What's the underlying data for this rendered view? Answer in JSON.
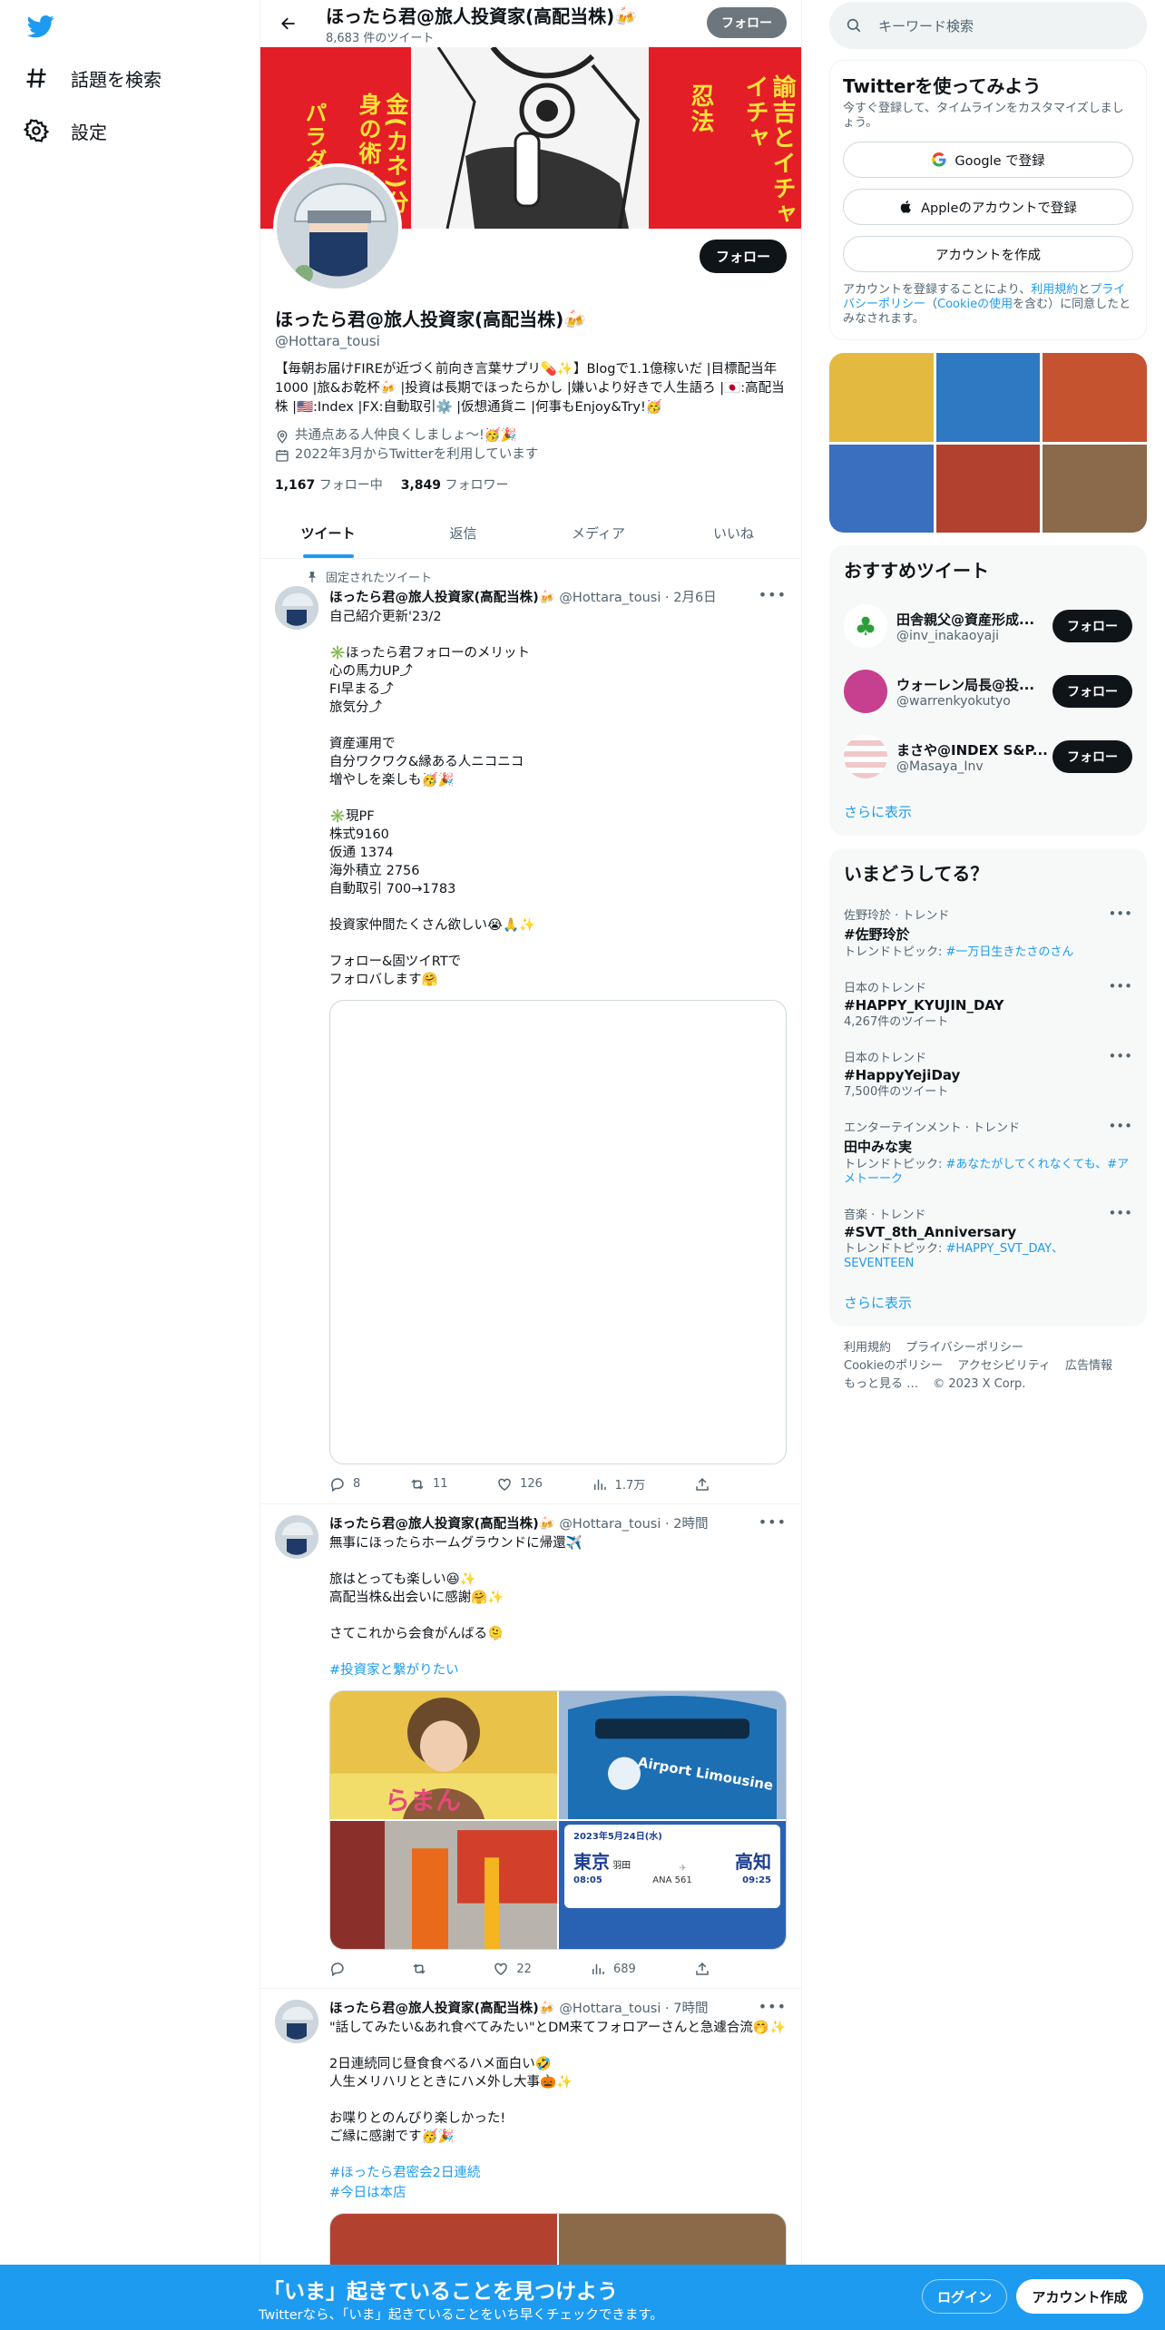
{
  "nav": {
    "explore": "話題を検索",
    "settings": "設定"
  },
  "header": {
    "name": "ほったら君@旅人投資家(高配当株)🍻",
    "tweet_count": "8,683 件のツイート",
    "follow": "フォロー"
  },
  "banner": {
    "left_text": "パラダイス",
    "center_text": "金(カネ)分身の術♪",
    "right_text1": "忍法",
    "right_text2": "諭吉とイチャイチャ"
  },
  "profile": {
    "name": "ほったら君@旅人投資家(高配当株)🍻",
    "handle": "@Hottara_tousi",
    "follow": "フォロー",
    "bio": "【毎朝お届けFIREが近づく前向き言葉サプリ💊✨】Blogで1.1億稼いだ |目標配当年1000 |旅&お乾杯🍻 |投資は長期でほったらかし |嫌いより好きで人生語ろ |🇯🇵:高配当株 |🇺🇸:Index |FX:自動取引⚙️ |仮想通貨ニ |何事もEnjoy&Try!🥳",
    "location": "共通点ある人仲良くしましょ〜!🥳🎉",
    "joined": "2022年3月からTwitterを利用しています",
    "following_count": "1,167",
    "following_label": "フォロー中",
    "followers_count": "3,849",
    "followers_label": "フォロワー"
  },
  "tabs": [
    {
      "label": "ツイート",
      "active": true
    },
    {
      "label": "返信",
      "active": false
    },
    {
      "label": "メディア",
      "active": false
    },
    {
      "label": "いいね",
      "active": false
    }
  ],
  "tweets": [
    {
      "pinned": "固定されたツイート",
      "name": "ほったら君@旅人投資家(高配当株)🍻",
      "handle": "@Hottara_tousi",
      "time": "2月6日",
      "text": "自己紹介更新'23/2\n\n✳️ほったら君フォローのメリット\n心の馬力UP⤴︎\nFI早まる⤴︎\n旅気分⤴︎\n\n資産運用で\n自分ワクワク&縁ある人ニコニコ\n増やしを楽しも🥳🎉\n\n✳️現PF\n株式9160\n仮通 1374\n海外積立 2756\n自動取引 700→1783\n\n投資家仲間たくさん欲しい😭🙏✨\n\nフォロー&固ツイRTで\nフォロバします🤗",
      "replies": "8",
      "retweets": "11",
      "likes": "126",
      "views": "1.7万"
    },
    {
      "name": "ほったら君@旅人投資家(高配当株)🍻",
      "handle": "@Hottara_tousi",
      "time": "2時間",
      "text": "無事にほったらホームグラウンドに帰還✈️\n\n旅はとっても楽しい😆✨\n高配当株&出会いに感謝🤗✨\n\nさてこれから会食がんばる🫠",
      "hashtag": "#投資家と繋がりたい",
      "replies": "",
      "retweets": "",
      "likes": "22",
      "views": "689",
      "media": {
        "bus_label": "Airport Limousine",
        "ticket_date": "2023年5月24日(水)",
        "ticket_from": "東京",
        "ticket_from_sub": "羽田",
        "ticket_to": "高知",
        "ticket_dep": "08:05",
        "ticket_flight": "ANA 561",
        "ticket_arr": "09:25",
        "shop_sign": "らまん"
      }
    },
    {
      "name": "ほったら君@旅人投資家(高配当株)🍻",
      "handle": "@Hottara_tousi",
      "time": "7時間",
      "text": "\"話してみたい&あれ食べてみたい\"とDM来てフォロアーさんと急遽合流🤭✨\n\n2日連続同じ昼食食べるハメ面白い🤣\n人生メリハリとときにハメ外し大事🎃✨\n\nお喋りとのんびり楽しかった!\nご縁に感謝です🥳🎉",
      "hashtag1": "#ほったら君密会2日連続",
      "hashtag2": "#今日は本店"
    }
  ],
  "right": {
    "search_placeholder": "キーワード検索",
    "signup": {
      "title": "Twitterを使ってみよう",
      "sub": "今すぐ登録して、タイムラインをカスタマイズしましょう。",
      "google": "Google で登録",
      "apple": "Appleのアカウントで登録",
      "create": "アカウントを作成",
      "legal_1": "アカウントを登録することにより、",
      "legal_terms": "利用規約",
      "legal_2": "と",
      "legal_privacy": "プライバシーポリシー",
      "legal_3": "（",
      "legal_cookie": "Cookieの使用",
      "legal_4": "を含む）に同意したとみなされます。"
    },
    "who_to_follow": {
      "title": "おすすめツイート",
      "users": [
        {
          "name": "田舎親父@資産形成...",
          "handle": "@inv_inakaoyaji",
          "button": "フォロー",
          "color": "#ffffff"
        },
        {
          "name": "ウォーレン局長@投...",
          "handle": "@warrenkyokutyo",
          "button": "フォロー",
          "color": "#c7408f"
        },
        {
          "name": "まさや@INDEX S&P...",
          "handle": "@Masaya_Inv",
          "button": "フォロー",
          "color": "#f1c8c8"
        }
      ],
      "more": "さらに表示"
    },
    "trends": {
      "title": "いまどうしてる？",
      "items": [
        {
          "context": "佐野玲於 · トレンド",
          "title": "#佐野玲於",
          "sub_label": "トレンドトピック: ",
          "sub_link": "#一万日生きたさのさん"
        },
        {
          "context": "日本のトレンド",
          "title": "#HAPPY_KYUJIN_DAY",
          "sub_label": "4,267件のツイート",
          "sub_link": ""
        },
        {
          "context": "日本のトレンド",
          "title": "#HappyYejiDay",
          "sub_label": "7,500件のツイート",
          "sub_link": ""
        },
        {
          "context": "エンターテインメント · トレンド",
          "title": "田中みな実",
          "sub_label": "トレンドトピック: ",
          "sub_link": "#あなたがしてくれなくても、#アメトーーク"
        },
        {
          "context": "音楽 · トレンド",
          "title": "#SVT_8th_Anniversary",
          "sub_label": "トレンドトピック: ",
          "sub_link": "#HAPPY_SVT_DAY、SEVENTEEN"
        }
      ],
      "more": "さらに表示"
    },
    "footer": [
      "利用規約",
      "プライバシーポリシー",
      "Cookieのポリシー",
      "アクセシビリティ",
      "広告情報",
      "もっと見る …",
      "© 2023 X Corp."
    ]
  },
  "bottom": {
    "title": "「いま」起きていることを見つけよう",
    "sub": "Twitterなら、「いま」起きていることをいち早くチェックできます。",
    "login": "ログイン",
    "signup": "アカウント作成"
  },
  "colors": {
    "accent": "#1d9bf0",
    "banner_red": "#e41e26",
    "dark_button": "#0f1419"
  }
}
